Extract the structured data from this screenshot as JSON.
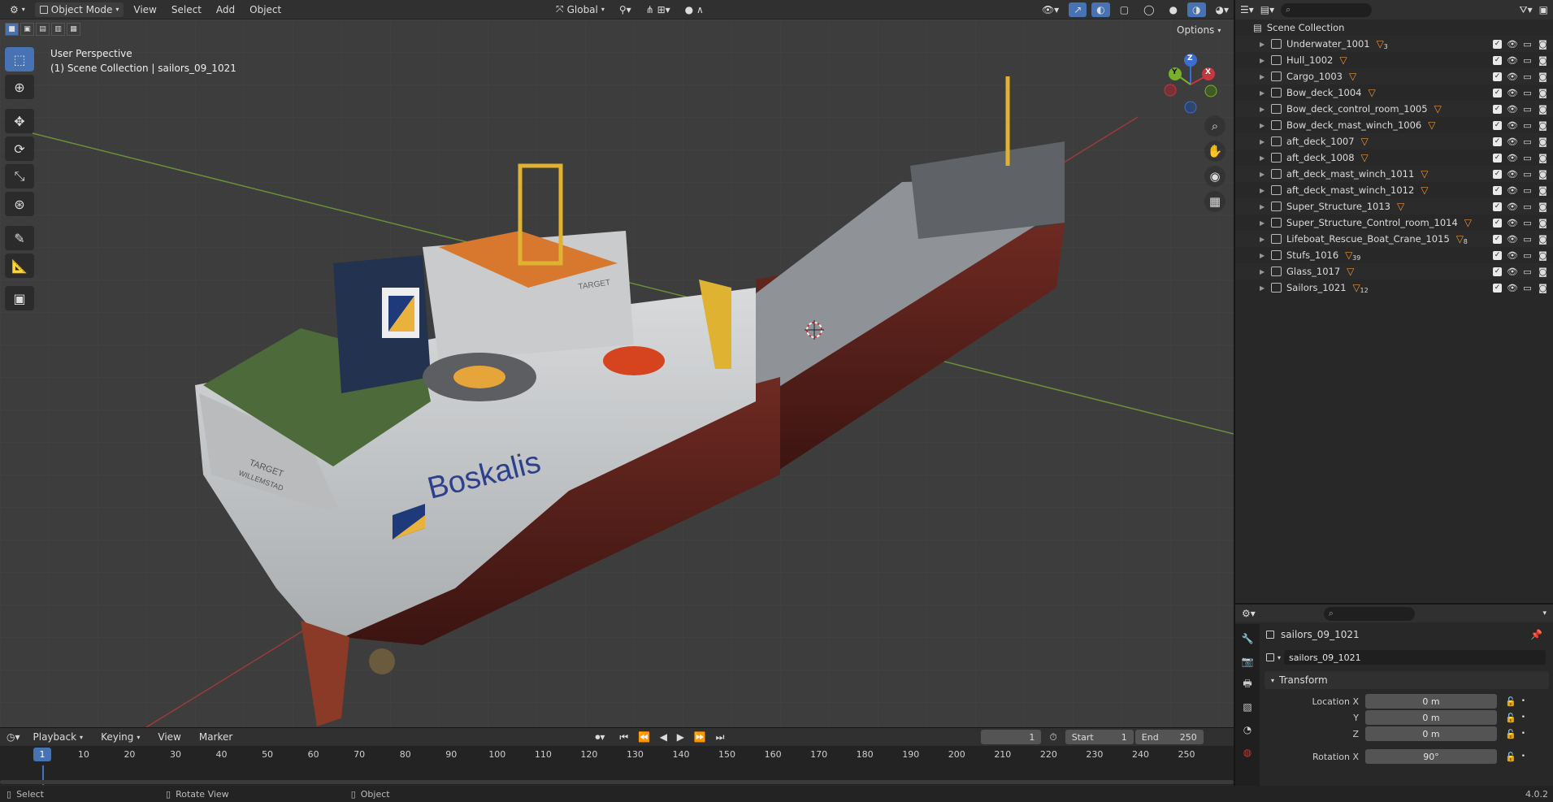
{
  "header": {
    "mode": "Object Mode",
    "menus": [
      "View",
      "Select",
      "Add",
      "Object"
    ],
    "orientation": "Global"
  },
  "viewport": {
    "overlay_title": "User Perspective",
    "overlay_collection": "(1) Scene Collection | sailors_09_1021",
    "options_label": "Options",
    "gizmo": {
      "x": "X",
      "y": "Y",
      "z": "Z"
    },
    "hull_text_brand": "Boskalis",
    "hull_text_name": "TARGET",
    "hull_text_port": "WILLEMSTAD",
    "structure_label": "TARGET"
  },
  "outliner": {
    "search_placeholder": "",
    "root": "Scene Collection",
    "items": [
      {
        "name": "Underwater_1001",
        "badge": "3"
      },
      {
        "name": "Hull_1002",
        "badge": ""
      },
      {
        "name": "Cargo_1003",
        "badge": ""
      },
      {
        "name": "Bow_deck_1004",
        "badge": ""
      },
      {
        "name": "Bow_deck_control_room_1005",
        "badge": ""
      },
      {
        "name": "Bow_deck_mast_winch_1006",
        "badge": ""
      },
      {
        "name": "aft_deck_1007",
        "badge": ""
      },
      {
        "name": "aft_deck_1008",
        "badge": ""
      },
      {
        "name": "aft_deck_mast_winch_1011",
        "badge": ""
      },
      {
        "name": "aft_deck_mast_winch_1012",
        "badge": ""
      },
      {
        "name": "Super_Structure_1013",
        "badge": ""
      },
      {
        "name": "Super_Structure_Control_room_1014",
        "badge": ""
      },
      {
        "name": "Lifeboat_Rescue_Boat_Crane_1015",
        "badge": "8"
      },
      {
        "name": "Stufs_1016",
        "badge": "39"
      },
      {
        "name": "Glass_1017",
        "badge": ""
      },
      {
        "name": "Sailors_1021",
        "badge": "12"
      }
    ]
  },
  "properties": {
    "object_name_header": "sailors_09_1021",
    "object_name_field": "sailors_09_1021",
    "panel_title": "Transform",
    "location_label": "Location X",
    "y_label": "Y",
    "z_label": "Z",
    "rotation_label": "Rotation X",
    "location_x": "0 m",
    "location_y": "0 m",
    "location_z": "0 m",
    "rotation_x": "90°"
  },
  "timeline": {
    "menus": [
      "Playback",
      "Keying",
      "View",
      "Marker"
    ],
    "current_frame": "1",
    "start_label": "Start",
    "start_value": "1",
    "end_label": "End",
    "end_value": "250",
    "ticks": [
      "1",
      "10",
      "20",
      "30",
      "40",
      "50",
      "60",
      "70",
      "80",
      "90",
      "100",
      "110",
      "120",
      "130",
      "140",
      "150",
      "160",
      "170",
      "180",
      "190",
      "200",
      "210",
      "220",
      "230",
      "240",
      "250"
    ]
  },
  "status": {
    "select": "Select",
    "rotate": "Rotate View",
    "object": "Object",
    "version": "4.0.2"
  }
}
